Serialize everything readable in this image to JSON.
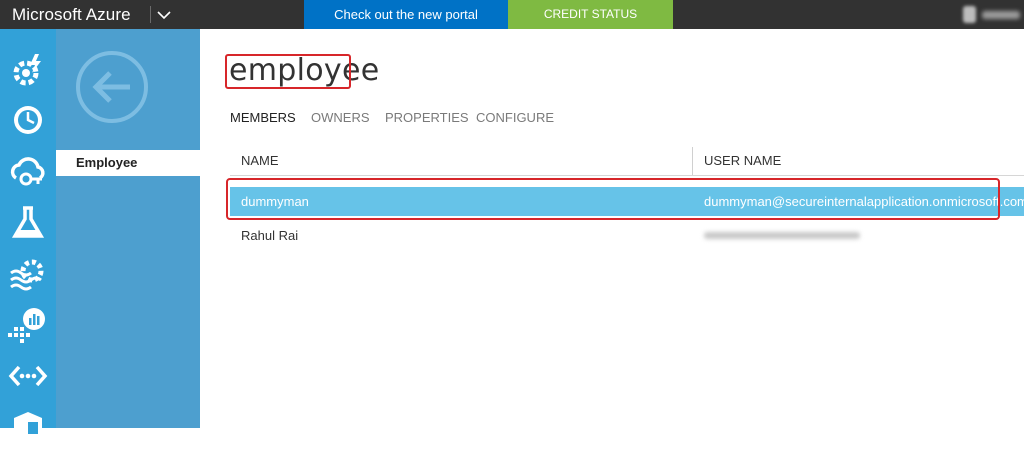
{
  "topbar": {
    "brand": "Microsoft Azure",
    "portal_button": "Check out the new portal",
    "credit_button": "CREDIT STATUS",
    "colors": {
      "bar": "#323232",
      "portal": "#0072c6",
      "credit": "#7fba42"
    }
  },
  "rail": {
    "icons": [
      "services-icon",
      "scheduler-icon",
      "cloud-sync-icon",
      "machine-learning-icon",
      "stream-analytics-icon",
      "operational-insights-icon",
      "networks-icon",
      "more-icon"
    ],
    "color": "#32a1d8"
  },
  "nav2": {
    "back_icon": "back-arrow-icon",
    "items": [
      {
        "label": "Employee"
      }
    ]
  },
  "page": {
    "title": "employee",
    "tabs": [
      {
        "label": "MEMBERS",
        "active": true
      },
      {
        "label": "OWNERS"
      },
      {
        "label": "PROPERTIES"
      },
      {
        "label": "CONFIGURE"
      }
    ]
  },
  "table": {
    "columns": [
      "NAME",
      "USER NAME"
    ],
    "rows": [
      {
        "name": "dummyman",
        "user_name": "dummyman@secureinternalapplication.onmicrosoft.com",
        "selected": true
      },
      {
        "name": "Rahul Rai",
        "user_name": ""
      }
    ]
  }
}
